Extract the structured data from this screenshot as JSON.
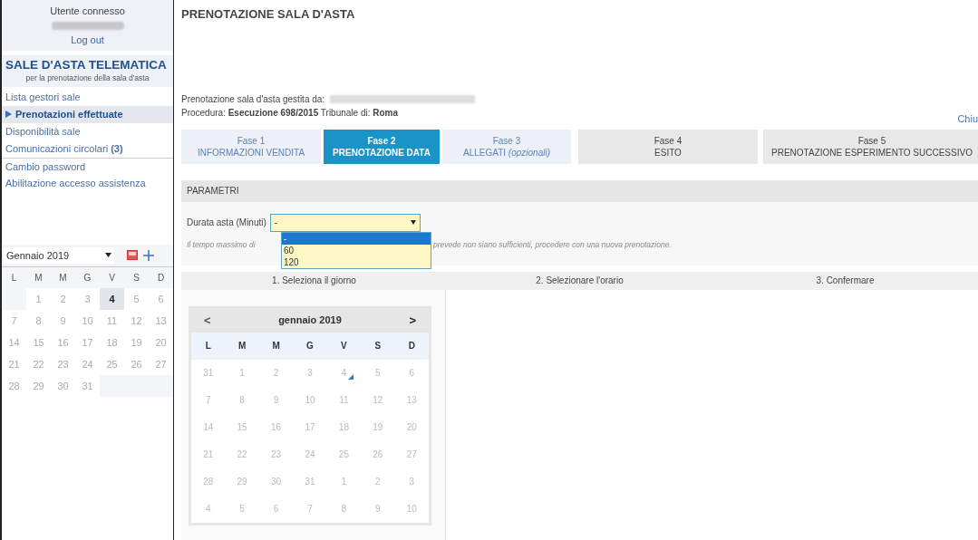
{
  "sidebar": {
    "user_label": "Utente connesso",
    "logout": "Log out",
    "brand_title": "SALE D'ASTA TELEMATICA",
    "brand_subtitle": "per la prenotazione della sala d'asta",
    "menu": [
      {
        "label": "Lista gestori sale",
        "selected": false
      },
      {
        "label": "Prenotazioni effettuate",
        "selected": true
      },
      {
        "label": "Disponibilità sale",
        "selected": false
      },
      {
        "label": "Comunicazioni circolari **(3)**",
        "selected": false
      },
      {
        "label": "Cambio password",
        "selected": false,
        "separator": true
      },
      {
        "label": "Abilitazione accesso assistenza",
        "selected": false
      }
    ],
    "mini_calendar": {
      "month": "Gennaio 2019",
      "weekdays": [
        "L",
        "M",
        "M",
        "G",
        "V",
        "S",
        "D"
      ],
      "weeks": [
        [
          {
            "label": "1",
            "selected": false
          },
          {
            "label": "2",
            "selected": false
          },
          {
            "label": "3",
            "selected": false
          },
          {
            "label": "4",
            "selected": true
          },
          {
            "label": "5",
            "selected": false
          },
          {
            "label": "6",
            "selected": false
          }
        ],
        [
          {
            "label": "7",
            "selected": false
          },
          {
            "label": "8",
            "selected": false
          },
          {
            "label": "9",
            "selected": false
          },
          {
            "label": "10",
            "selected": false
          },
          {
            "label": "11",
            "selected": false
          },
          {
            "label": "12",
            "selected": false
          },
          {
            "label": "13",
            "selected": false
          }
        ],
        [
          {
            "label": "14",
            "selected": false
          },
          {
            "label": "15",
            "selected": false
          },
          {
            "label": "16",
            "selected": false
          },
          {
            "label": "17",
            "selected": false
          },
          {
            "label": "18",
            "selected": false
          },
          {
            "label": "19",
            "selected": false
          },
          {
            "label": "20",
            "selected": false
          }
        ],
        [
          {
            "label": "21",
            "selected": false
          },
          {
            "label": "22",
            "selected": false
          },
          {
            "label": "23",
            "selected": false
          },
          {
            "label": "24",
            "selected": false
          },
          {
            "label": "25",
            "selected": false
          },
          {
            "label": "26",
            "selected": false
          },
          {
            "label": "27",
            "selected": false
          }
        ],
        [
          {
            "label": "28",
            "selected": false
          },
          {
            "label": "29",
            "selected": false
          },
          {
            "label": "30",
            "selected": false
          },
          {
            "label": "31",
            "selected": false
          }
        ]
      ]
    }
  },
  "page_title": "PRENOTAZIONE SALA D'ASTA",
  "manager_label": "Prenotazione sala d'asta gestita da:",
  "procedure": "Procedura: **Esecuzione 698/2015** Tribunale di: **Roma**",
  "close_link": "Chiu",
  "phases": [
    {
      "step": "Fase 1",
      "name": "INFORMAZIONI VENDITA",
      "selected": false,
      "disabled": false
    },
    {
      "step": "Fase 2",
      "name": "PRENOTAZIONE DATA",
      "selected": true,
      "disabled": false
    },
    {
      "step": "Fase 3",
      "name": "ALLEGATI *(opzionali)*",
      "selected": false,
      "disabled": false
    },
    {
      "step": "Fase 4",
      "name": "ESITO",
      "selected": false,
      "disabled": true
    },
    {
      "step": "Fase 5",
      "name": "PRENOTAZIONE ESPERIMENTO SUCCESSIVO",
      "selected": false,
      "disabled": true
    }
  ],
  "parameters": {
    "heading": "PARAMETRI",
    "duration_label": "Durata asta (Minuti)",
    "duration_value": "-",
    "options": [
      {
        "label": "-",
        "selected": true
      },
      {
        "label": "60",
        "selected": false
      },
      {
        "label": "120",
        "selected": false
      }
    ],
    "hint_start": "Il tempo massimo di",
    "hint_end": "prevede non siano sufficienti, procedere con una nuova prenotazione."
  },
  "steps": [
    "1. Seleziona il giorno",
    "2. Selezionare l'orario",
    "3. Confermare"
  ],
  "calendar": {
    "prev": "<",
    "month": "gennaio 2019",
    "next": ">",
    "weekdays": [
      "L",
      "M",
      "M",
      "G",
      "V",
      "S",
      "D"
    ],
    "weeks": [
      [
        {
          "label": "31",
          "marked": false
        },
        {
          "label": "1",
          "marked": false
        },
        {
          "label": "2",
          "marked": false
        },
        {
          "label": "3",
          "marked": false
        },
        {
          "label": "4",
          "marked": true
        },
        {
          "label": "5",
          "marked": false
        },
        {
          "label": "6",
          "marked": false
        }
      ],
      [
        {
          "label": "7",
          "marked": false
        },
        {
          "label": "8",
          "marked": false
        },
        {
          "label": "9",
          "marked": false
        },
        {
          "label": "10",
          "marked": false
        },
        {
          "label": "11",
          "marked": false
        },
        {
          "label": "12",
          "marked": false
        },
        {
          "label": "13",
          "marked": false
        }
      ],
      [
        {
          "label": "14",
          "marked": false
        },
        {
          "label": "15",
          "marked": false
        },
        {
          "label": "16",
          "marked": false
        },
        {
          "label": "17",
          "marked": false
        },
        {
          "label": "18",
          "marked": false
        },
        {
          "label": "19",
          "marked": false
        },
        {
          "label": "20",
          "marked": false
        }
      ],
      [
        {
          "label": "21",
          "marked": false
        },
        {
          "label": "22",
          "marked": false
        },
        {
          "label": "23",
          "marked": false
        },
        {
          "label": "24",
          "marked": false
        },
        {
          "label": "25",
          "marked": false
        },
        {
          "label": "26",
          "marked": false
        },
        {
          "label": "27",
          "marked": false
        }
      ],
      [
        {
          "label": "28",
          "marked": false
        },
        {
          "label": "29",
          "marked": false
        },
        {
          "label": "30",
          "marked": false
        },
        {
          "label": "31",
          "marked": false
        },
        {
          "label": "1",
          "marked": false
        },
        {
          "label": "2",
          "marked": false
        },
        {
          "label": "3",
          "marked": false
        }
      ],
      [
        {
          "label": "4",
          "marked": false
        },
        {
          "label": "5",
          "marked": false
        },
        {
          "label": "6",
          "marked": false
        },
        {
          "label": "7",
          "marked": false
        },
        {
          "label": "8",
          "marked": false
        },
        {
          "label": "9",
          "marked": false
        },
        {
          "label": "10",
          "marked": false
        }
      ]
    ]
  }
}
